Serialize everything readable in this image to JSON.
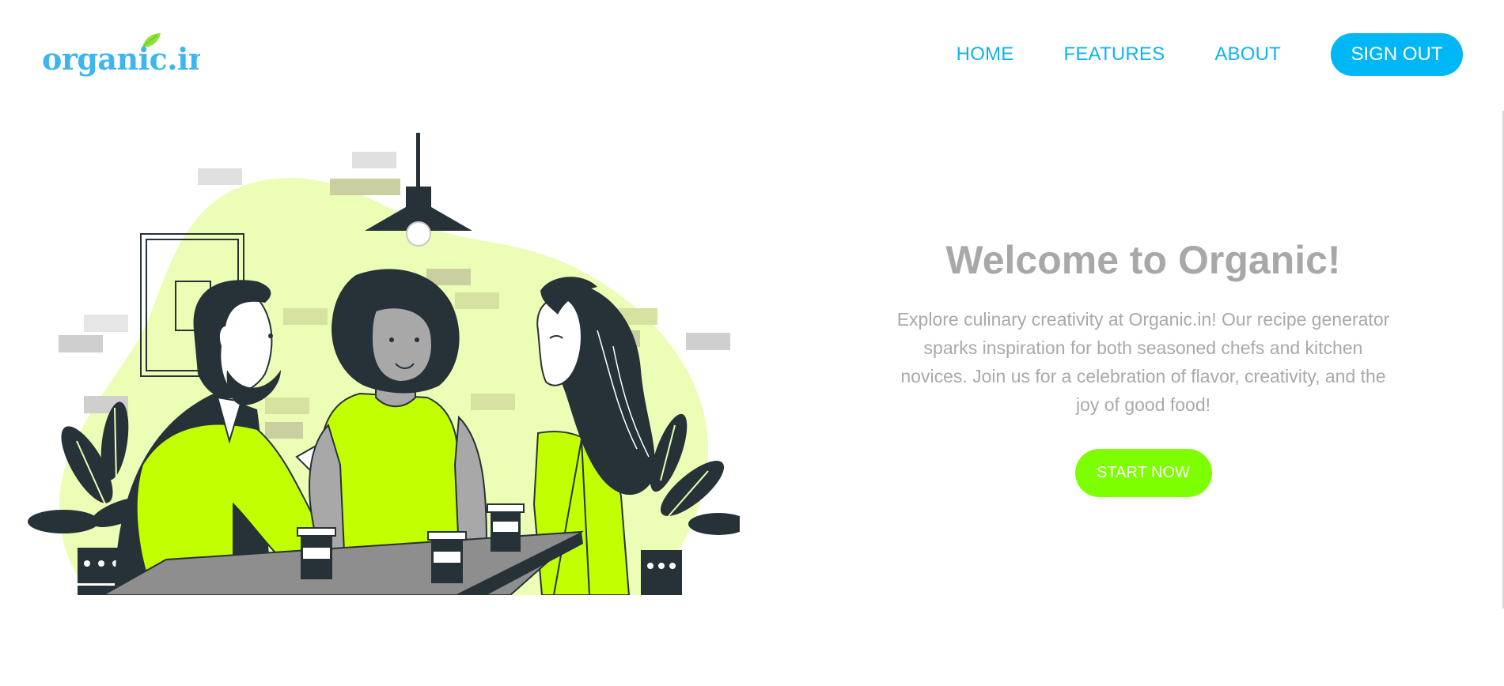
{
  "brand": {
    "logo_text": "organic.in",
    "logo_color": "#3db5f0",
    "leaf_color": "#8ee13c"
  },
  "nav": {
    "items": [
      {
        "label": "HOME"
      },
      {
        "label": "FEATURES"
      },
      {
        "label": "ABOUT"
      }
    ],
    "signout_label": "SIGN OUT",
    "link_color": "#0fb3ee",
    "button_color": "#00b7f5"
  },
  "hero": {
    "title": "Welcome to Organic!",
    "description": "Explore culinary creativity at Organic.in! Our recipe generator sparks inspiration for both seasoned chefs and kitchen novices. Join us for a celebration of flavor, creativity, and the joy of good food!",
    "cta_label": "START NOW",
    "cta_color": "#7eff00",
    "text_color": "#a9a9a9"
  },
  "illustration": {
    "subject": "three friends chatting over coffee at a table",
    "accent_color": "#c2ff00",
    "blob_color": "#ecfdb5",
    "ink_color": "#263238"
  }
}
